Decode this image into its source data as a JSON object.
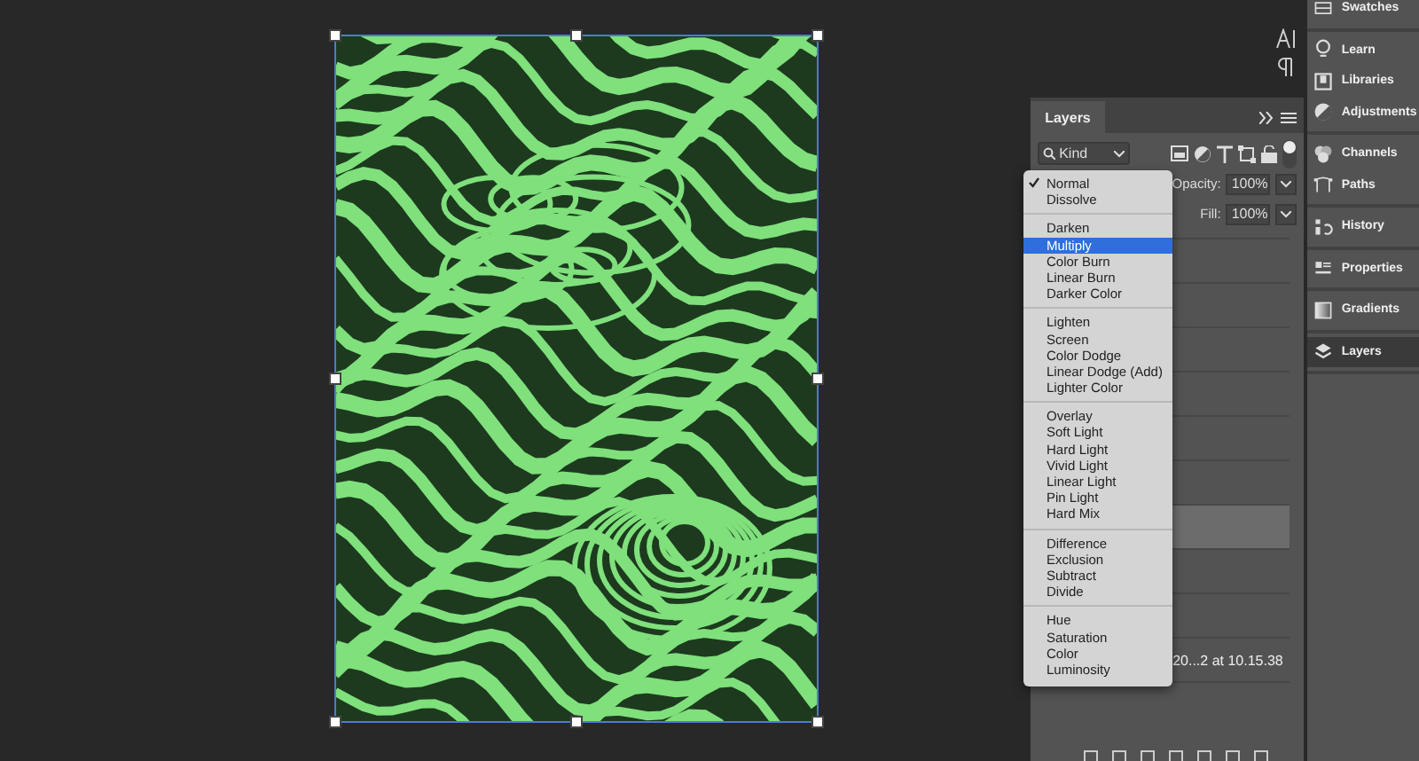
{
  "layers_panel": {
    "tab": {
      "label": "Layers",
      "selected": true
    },
    "filter": {
      "value": "Kind"
    },
    "opacity": {
      "label": "Opacity:",
      "value": "100%"
    },
    "fill": {
      "label": "Fill:",
      "value": "100%"
    },
    "layers": [
      {
        "selected": false
      },
      {
        "selected": false
      },
      {
        "selected": false
      },
      {
        "selected": false
      },
      {
        "selected": false
      },
      {
        "selected": false
      },
      {
        "selected": true
      },
      {
        "selected": false
      },
      {
        "selected": false
      },
      {
        "selected": false,
        "name": "20...2 at 10.15.38"
      }
    ]
  },
  "blend_menu": {
    "groups": [
      {
        "items": [
          {
            "label": "Normal",
            "checked": true,
            "selected": false
          },
          {
            "label": "Dissolve",
            "checked": false,
            "selected": false
          }
        ]
      },
      {
        "items": [
          {
            "label": "Darken",
            "checked": false,
            "selected": false
          },
          {
            "label": "Multiply",
            "checked": false,
            "selected": true
          },
          {
            "label": "Color Burn",
            "checked": false,
            "selected": false
          },
          {
            "label": "Linear Burn",
            "checked": false,
            "selected": false
          },
          {
            "label": "Darker Color",
            "checked": false,
            "selected": false
          }
        ]
      },
      {
        "items": [
          {
            "label": "Lighten",
            "checked": false,
            "selected": false
          },
          {
            "label": "Screen",
            "checked": false,
            "selected": false
          },
          {
            "label": "Color Dodge",
            "checked": false,
            "selected": false
          },
          {
            "label": "Linear Dodge (Add)",
            "checked": false,
            "selected": false
          },
          {
            "label": "Lighter Color",
            "checked": false,
            "selected": false
          }
        ]
      },
      {
        "items": [
          {
            "label": "Overlay",
            "checked": false,
            "selected": false
          },
          {
            "label": "Soft Light",
            "checked": false,
            "selected": false
          },
          {
            "label": "Hard Light",
            "checked": false,
            "selected": false
          },
          {
            "label": "Vivid Light",
            "checked": false,
            "selected": false
          },
          {
            "label": "Linear Light",
            "checked": false,
            "selected": false
          },
          {
            "label": "Pin Light",
            "checked": false,
            "selected": false
          },
          {
            "label": "Hard Mix",
            "checked": false,
            "selected": false
          }
        ]
      },
      {
        "items": [
          {
            "label": "Difference",
            "checked": false,
            "selected": false
          },
          {
            "label": "Exclusion",
            "checked": false,
            "selected": false
          },
          {
            "label": "Subtract",
            "checked": false,
            "selected": false
          },
          {
            "label": "Divide",
            "checked": false,
            "selected": false
          }
        ]
      },
      {
        "items": [
          {
            "label": "Hue",
            "checked": false,
            "selected": false
          },
          {
            "label": "Saturation",
            "checked": false,
            "selected": false
          },
          {
            "label": "Color",
            "checked": false,
            "selected": false
          },
          {
            "label": "Luminosity",
            "checked": false,
            "selected": false
          }
        ]
      }
    ]
  },
  "dock": {
    "groups": [
      {
        "items": [
          {
            "kind": "swatches",
            "label": "Swatches",
            "selected": false
          }
        ]
      },
      {
        "items": [
          {
            "kind": "learn",
            "label": "Learn",
            "selected": false
          },
          {
            "kind": "libraries",
            "label": "Libraries",
            "selected": false
          },
          {
            "kind": "adjustments",
            "label": "Adjustments",
            "selected": false
          }
        ]
      },
      {
        "items": [
          {
            "kind": "channels",
            "label": "Channels",
            "selected": false
          },
          {
            "kind": "paths",
            "label": "Paths",
            "selected": false
          }
        ]
      },
      {
        "items": [
          {
            "kind": "history",
            "label": "History",
            "selected": false
          }
        ]
      },
      {
        "items": [
          {
            "kind": "properties",
            "label": "Properties",
            "selected": false
          }
        ]
      },
      {
        "items": [
          {
            "kind": "gradients",
            "label": "Gradients",
            "selected": false
          }
        ]
      },
      {
        "items": [
          {
            "kind": "layers",
            "label": "Layers",
            "selected": true
          }
        ]
      }
    ]
  }
}
